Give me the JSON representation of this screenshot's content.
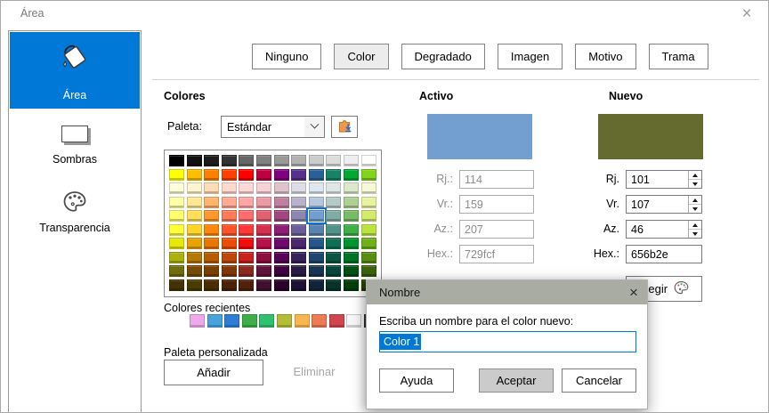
{
  "window": {
    "title": "Área",
    "close": "×"
  },
  "sidebar": {
    "items": [
      {
        "label": "Área",
        "selected": true,
        "icon": "paint-bucket-icon"
      },
      {
        "label": "Sombras",
        "selected": false,
        "icon": "shadow-rect-icon"
      },
      {
        "label": "Transparencia",
        "selected": false,
        "icon": "palette-icon"
      }
    ]
  },
  "fill_types": {
    "selected": "Color",
    "buttons": [
      {
        "label": "Ninguno"
      },
      {
        "label": "Color"
      },
      {
        "label": "Degradado"
      },
      {
        "label": "Imagen"
      },
      {
        "label": "Motivo"
      },
      {
        "label": "Trama"
      }
    ]
  },
  "colors": {
    "heading": "Colores",
    "palette_label": "Paleta:",
    "palette_selected": "Estándar",
    "grid_selected": {
      "row": 4,
      "col": 8,
      "hex": "#729FCF"
    },
    "grid_rows": [
      [
        "#000000",
        "#111111",
        "#1C1C1C",
        "#333333",
        "#666666",
        "#808080",
        "#999999",
        "#B2B2B2",
        "#CCCCCC",
        "#DDDDDD",
        "#EEEEEE",
        "#FFFFFF"
      ],
      [
        "#FFFF00",
        "#FFBF00",
        "#FF8000",
        "#FF4000",
        "#FF0000",
        "#BF0041",
        "#800080",
        "#55308D",
        "#2A6099",
        "#158466",
        "#00A933",
        "#81D41A"
      ],
      [
        "#FFFFD7",
        "#FFF5CE",
        "#FFDBB6",
        "#FFD8CE",
        "#FFD7D7",
        "#F7D1D5",
        "#E0C2CD",
        "#DEDCE6",
        "#DEE6EF",
        "#DEE7E5",
        "#DDE8CB",
        "#F6F9D4"
      ],
      [
        "#FFFFA6",
        "#FFE994",
        "#FFB66C",
        "#FFAA95",
        "#FFA6A6",
        "#EC9BA4",
        "#BF819E",
        "#B7B3CA",
        "#B4C7DC",
        "#B3CAC7",
        "#AFD095",
        "#E8F2A1"
      ],
      [
        "#FFFF6D",
        "#FFDE59",
        "#FF972F",
        "#FF7B59",
        "#FF6D6D",
        "#E16173",
        "#A1467E",
        "#8E86AE",
        "#729FCF",
        "#81ACA6",
        "#77BC65",
        "#D4EA6B"
      ],
      [
        "#FFFF38",
        "#FFD428",
        "#FF860D",
        "#FF5429",
        "#FF3838",
        "#D62E4E",
        "#8D1D75",
        "#6B5E9B",
        "#5983B0",
        "#50938A",
        "#3FAF46",
        "#BBE33D"
      ],
      [
        "#E6E905",
        "#E8A202",
        "#EA7500",
        "#ED4C05",
        "#F10D0C",
        "#B8104B",
        "#6E0A6E",
        "#49266D",
        "#27568C",
        "#0E6E56",
        "#00932F",
        "#6DB017"
      ],
      [
        "#ACB20C",
        "#B47804",
        "#B85C00",
        "#BE480A",
        "#C9211E",
        "#8D0E3F",
        "#560456",
        "#37215A",
        "#1E4670",
        "#0A5643",
        "#007326",
        "#578E11"
      ],
      [
        "#706E0C",
        "#784B04",
        "#7B3D00",
        "#813709",
        "#8D281E",
        "#61123A",
        "#3E023E",
        "#281A45",
        "#173455",
        "#07453A",
        "#034F14",
        "#3C620C"
      ],
      [
        "#443205",
        "#473B02",
        "#492C00",
        "#4B2204",
        "#50200C",
        "#41102E",
        "#2B012B",
        "#1C1034",
        "#102338",
        "#05332A",
        "#023F0A",
        "#2A4406"
      ]
    ],
    "recent_heading": "Colores recientes",
    "recent": [
      "#EEA9ED",
      "#47A3DC",
      "#2D7FD6",
      "#3FAE49",
      "#2EC26E",
      "#B5BD38",
      "#F9B64E",
      "#EF7B54",
      "#D2444E",
      "#F7F7F7",
      "#3A3A3A",
      "#111111"
    ],
    "custom_heading": "Paleta personalizada",
    "add_label": "Añadir",
    "delete_label": "Eliminar"
  },
  "active": {
    "heading": "Activo",
    "swatch": "#729FCF",
    "r_label": "Rj.:",
    "r": "114",
    "g_label": "Vr.:",
    "g": "159",
    "b_label": "Az.:",
    "b": "207",
    "hex_label": "Hex.:",
    "hex": "729fcf"
  },
  "new": {
    "heading": "Nuevo",
    "swatch": "#656B2E",
    "r_label": "Rj.",
    "r": "101",
    "g_label": "Vr.",
    "g": "107",
    "b_label": "Az.",
    "b": "46",
    "hex_label": "Hex.:",
    "hex": "656b2e",
    "pick_label": "Elegir"
  },
  "name_dialog": {
    "title": "Nombre",
    "close": "×",
    "prompt": "Escriba un nombre para el color nuevo:",
    "value": "Color 1",
    "help": "Ayuda",
    "ok": "Aceptar",
    "cancel": "Cancelar"
  }
}
